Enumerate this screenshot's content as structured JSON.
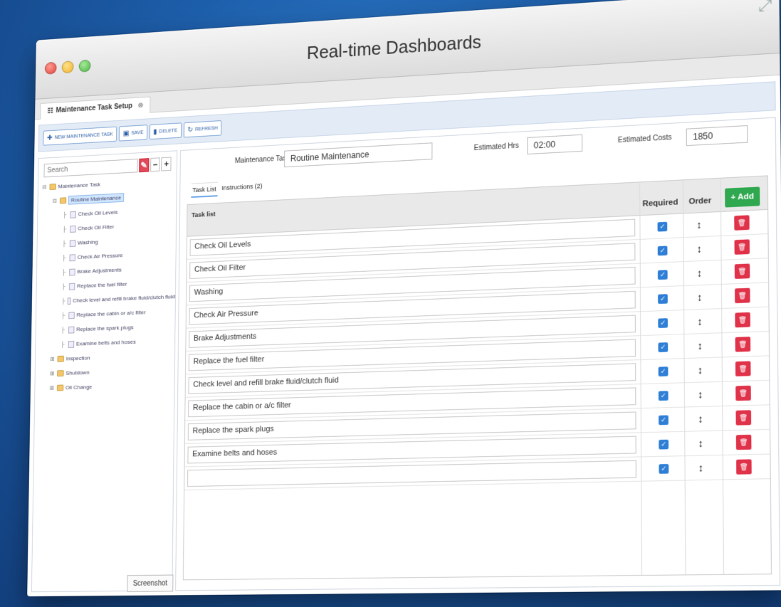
{
  "window": {
    "title": "Real-time Dashboards"
  },
  "doc_tab": {
    "label": "Maintenance Task Setup"
  },
  "toolbar": {
    "new_label": "New Maintenance Task",
    "save_label": "Save",
    "delete_label": "Delete",
    "refresh_label": "Refresh"
  },
  "tree_panel": {
    "search_placeholder": "Search",
    "minus_label": "−",
    "plus_label": "+",
    "screenshot_tab": "Screenshot",
    "nodes": [
      {
        "label": "Maintenance Task",
        "level": 0,
        "type": "folder",
        "selected": false
      },
      {
        "label": "Routine Maintenance",
        "level": 1,
        "type": "folder",
        "selected": true
      },
      {
        "label": "Check Oil Levels",
        "level": 2,
        "type": "file",
        "selected": false
      },
      {
        "label": "Check Oil Filter",
        "level": 2,
        "type": "file",
        "selected": false
      },
      {
        "label": "Washing",
        "level": 2,
        "type": "file",
        "selected": false
      },
      {
        "label": "Check Air Pressure",
        "level": 2,
        "type": "file",
        "selected": false
      },
      {
        "label": "Brake Adjustments",
        "level": 2,
        "type": "file",
        "selected": false
      },
      {
        "label": "Replace the fuel filter",
        "level": 2,
        "type": "file",
        "selected": false
      },
      {
        "label": "Check level and refill brake fluid/clutch fluid",
        "level": 2,
        "type": "file",
        "selected": false
      },
      {
        "label": "Replace the cabin or a/c filter",
        "level": 2,
        "type": "file",
        "selected": false
      },
      {
        "label": "Replace the spark plugs",
        "level": 2,
        "type": "file",
        "selected": false
      },
      {
        "label": "Examine belts and hoses",
        "level": 2,
        "type": "file",
        "selected": false
      },
      {
        "label": "Inspection",
        "level": 1,
        "type": "folder",
        "selected": false
      },
      {
        "label": "Shutdown",
        "level": 1,
        "type": "folder",
        "selected": false
      },
      {
        "label": "Oil Change",
        "level": 1,
        "type": "folder",
        "selected": false
      }
    ]
  },
  "form": {
    "task_label": "Maintenance Task",
    "task_value": "Routine Maintenance",
    "hrs_label": "Estimated Hrs",
    "hrs_value": "02:00",
    "costs_label": "Estimated Costs",
    "costs_value": "1850"
  },
  "subtabs": [
    {
      "label": "Task List",
      "active": true
    },
    {
      "label": "Instructions (2)",
      "active": false
    }
  ],
  "grid": {
    "task_header": "Task list",
    "required_header": "Required",
    "order_header": "Order",
    "add_label": "+ Add",
    "rows": [
      {
        "task": "Check Oil Levels",
        "required": true
      },
      {
        "task": "Check Oil Filter",
        "required": true
      },
      {
        "task": "Washing",
        "required": true
      },
      {
        "task": "Check Air Pressure",
        "required": true
      },
      {
        "task": "Brake Adjustments",
        "required": true
      },
      {
        "task": "Replace the fuel filter",
        "required": true
      },
      {
        "task": "Check level and refill brake fluid/clutch fluid",
        "required": true
      },
      {
        "task": "Replace the cabin or a/c filter",
        "required": true
      },
      {
        "task": "Replace the spark plugs",
        "required": true
      },
      {
        "task": "Examine belts and hoses",
        "required": true
      },
      {
        "task": "",
        "required": true
      }
    ]
  },
  "colors": {
    "background": "#1d5eaa",
    "add_button": "#2fa84f",
    "delete_button": "#e0334a",
    "checkbox": "#2f7fd6"
  }
}
